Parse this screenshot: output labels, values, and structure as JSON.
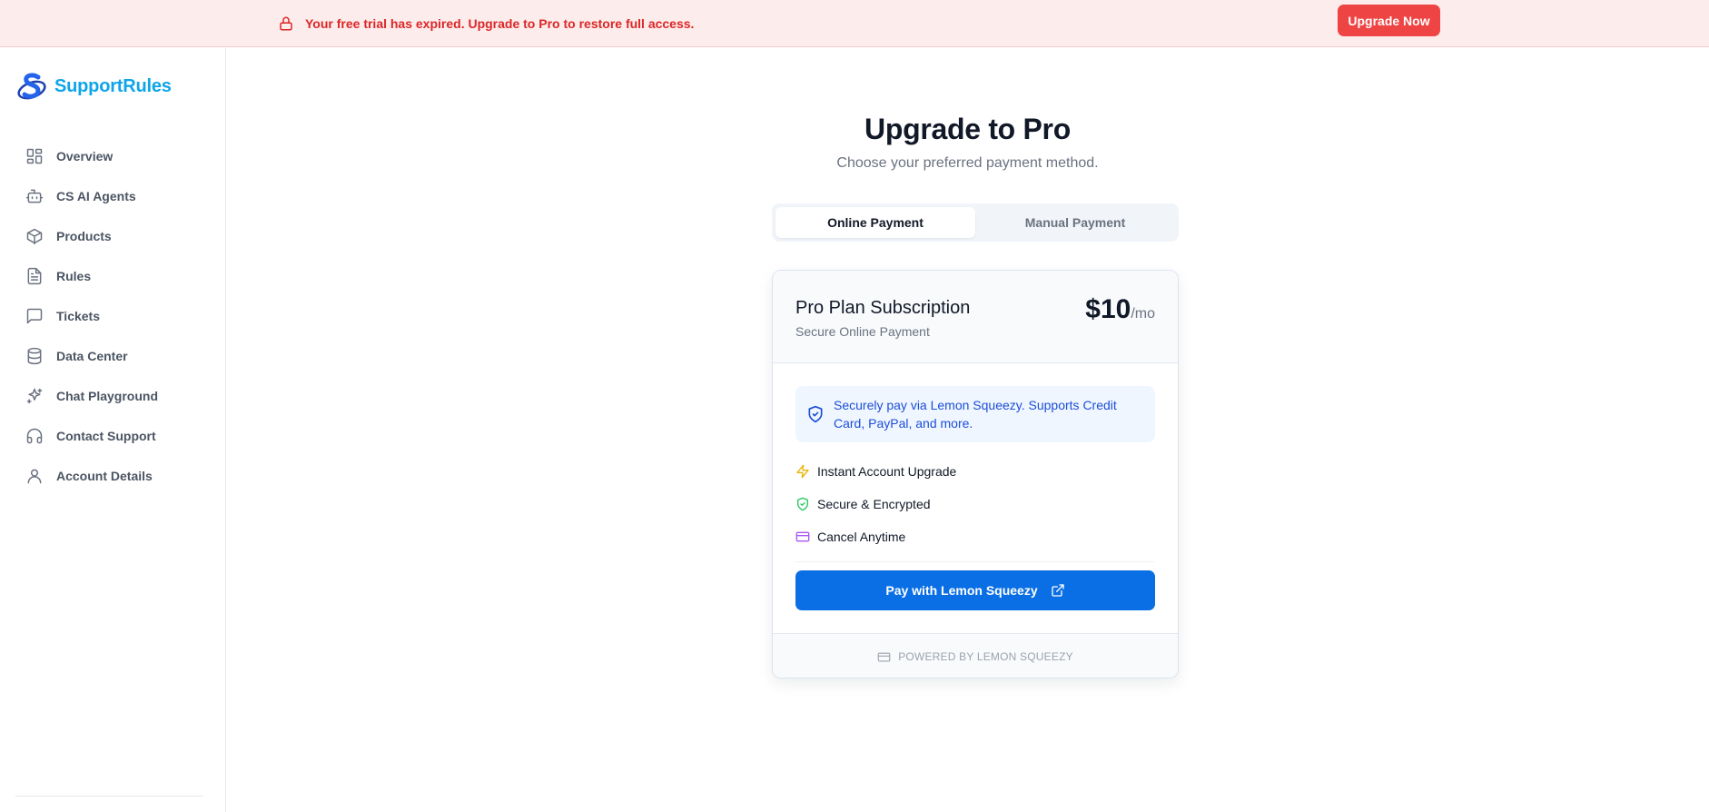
{
  "banner": {
    "icon": "lock-icon",
    "message": "Your free trial has expired. Upgrade to Pro to restore full access.",
    "cta_label": "Upgrade Now"
  },
  "brand": {
    "name": "SupportRules",
    "icon": "supportrules-logo"
  },
  "sidebar": {
    "items": [
      {
        "label": "Overview",
        "icon": "grid-icon"
      },
      {
        "label": "CS AI Agents",
        "icon": "bot-icon"
      },
      {
        "label": "Products",
        "icon": "box-icon"
      },
      {
        "label": "Rules",
        "icon": "file-text-icon"
      },
      {
        "label": "Tickets",
        "icon": "message-square-icon"
      },
      {
        "label": "Data Center",
        "icon": "database-icon"
      },
      {
        "label": "Chat Playground",
        "icon": "sparkles-icon"
      },
      {
        "label": "Contact Support",
        "icon": "headphones-icon"
      },
      {
        "label": "Account Details",
        "icon": "user-icon"
      }
    ]
  },
  "main": {
    "title": "Upgrade to Pro",
    "subtitle": "Choose your preferred payment method.",
    "tabs": [
      {
        "label": "Online Payment",
        "active": true
      },
      {
        "label": "Manual Payment",
        "active": false
      }
    ]
  },
  "card": {
    "plan_name": "Pro Plan Subscription",
    "plan_sub": "Secure Online Payment",
    "price": "$10",
    "per": "/mo",
    "info": "Securely pay via Lemon Squeezy. Supports Credit Card, PayPal, and more.",
    "features": [
      {
        "label": "Instant Account Upgrade",
        "icon": "zap-icon",
        "color": "#eab308"
      },
      {
        "label": "Secure & Encrypted",
        "icon": "shield-check-icon",
        "color": "#22c55e"
      },
      {
        "label": "Cancel Anytime",
        "icon": "credit-card-icon",
        "color": "#a855f7"
      }
    ],
    "pay_label": "Pay with Lemon Squeezy",
    "footer": "POWERED BY LEMON SQUEEZY"
  },
  "colors": {
    "accent": "#0a6fe5",
    "danger": "#ef4444",
    "brand": "#0ea5e9"
  }
}
